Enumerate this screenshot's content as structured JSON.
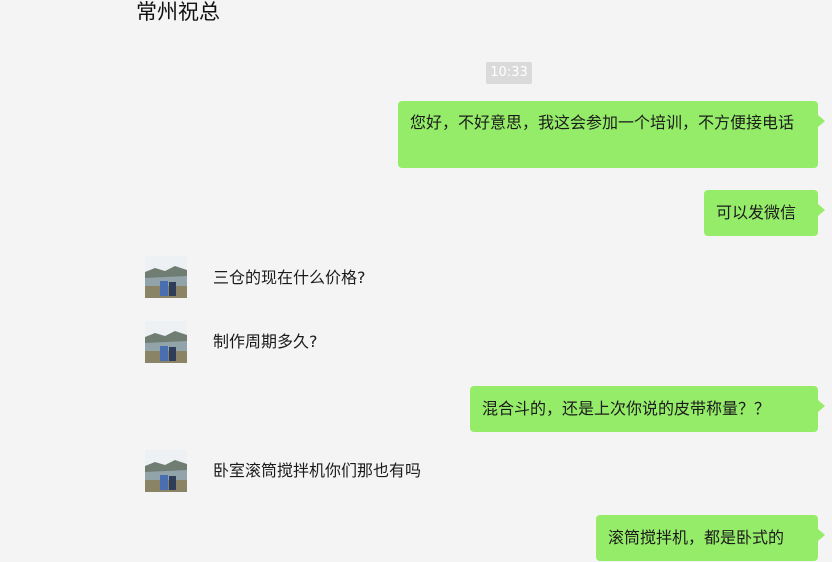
{
  "chat": {
    "title": "常州祝总",
    "time_divider": "10:33",
    "messages": [
      {
        "side": "out",
        "text": "您好，不好意思，我这会参加一个培训，不方便接电话"
      },
      {
        "side": "out",
        "text": "可以发微信"
      },
      {
        "side": "in",
        "text": "三仓的现在什么价格?"
      },
      {
        "side": "in",
        "text": "制作周期多久?"
      },
      {
        "side": "out",
        "text": "混合斗的，还是上次你说的皮带称量？？"
      },
      {
        "side": "in",
        "text": "卧室滚筒搅拌机你们那也有吗"
      },
      {
        "side": "out",
        "text": "滚筒搅拌机，都是卧式的"
      }
    ]
  },
  "colors": {
    "outgoing_bubble": "#95ec69",
    "background": "#f4f4f4",
    "time_badge": "#dadada"
  },
  "icons": {
    "avatar": "landscape-photo-avatar"
  }
}
